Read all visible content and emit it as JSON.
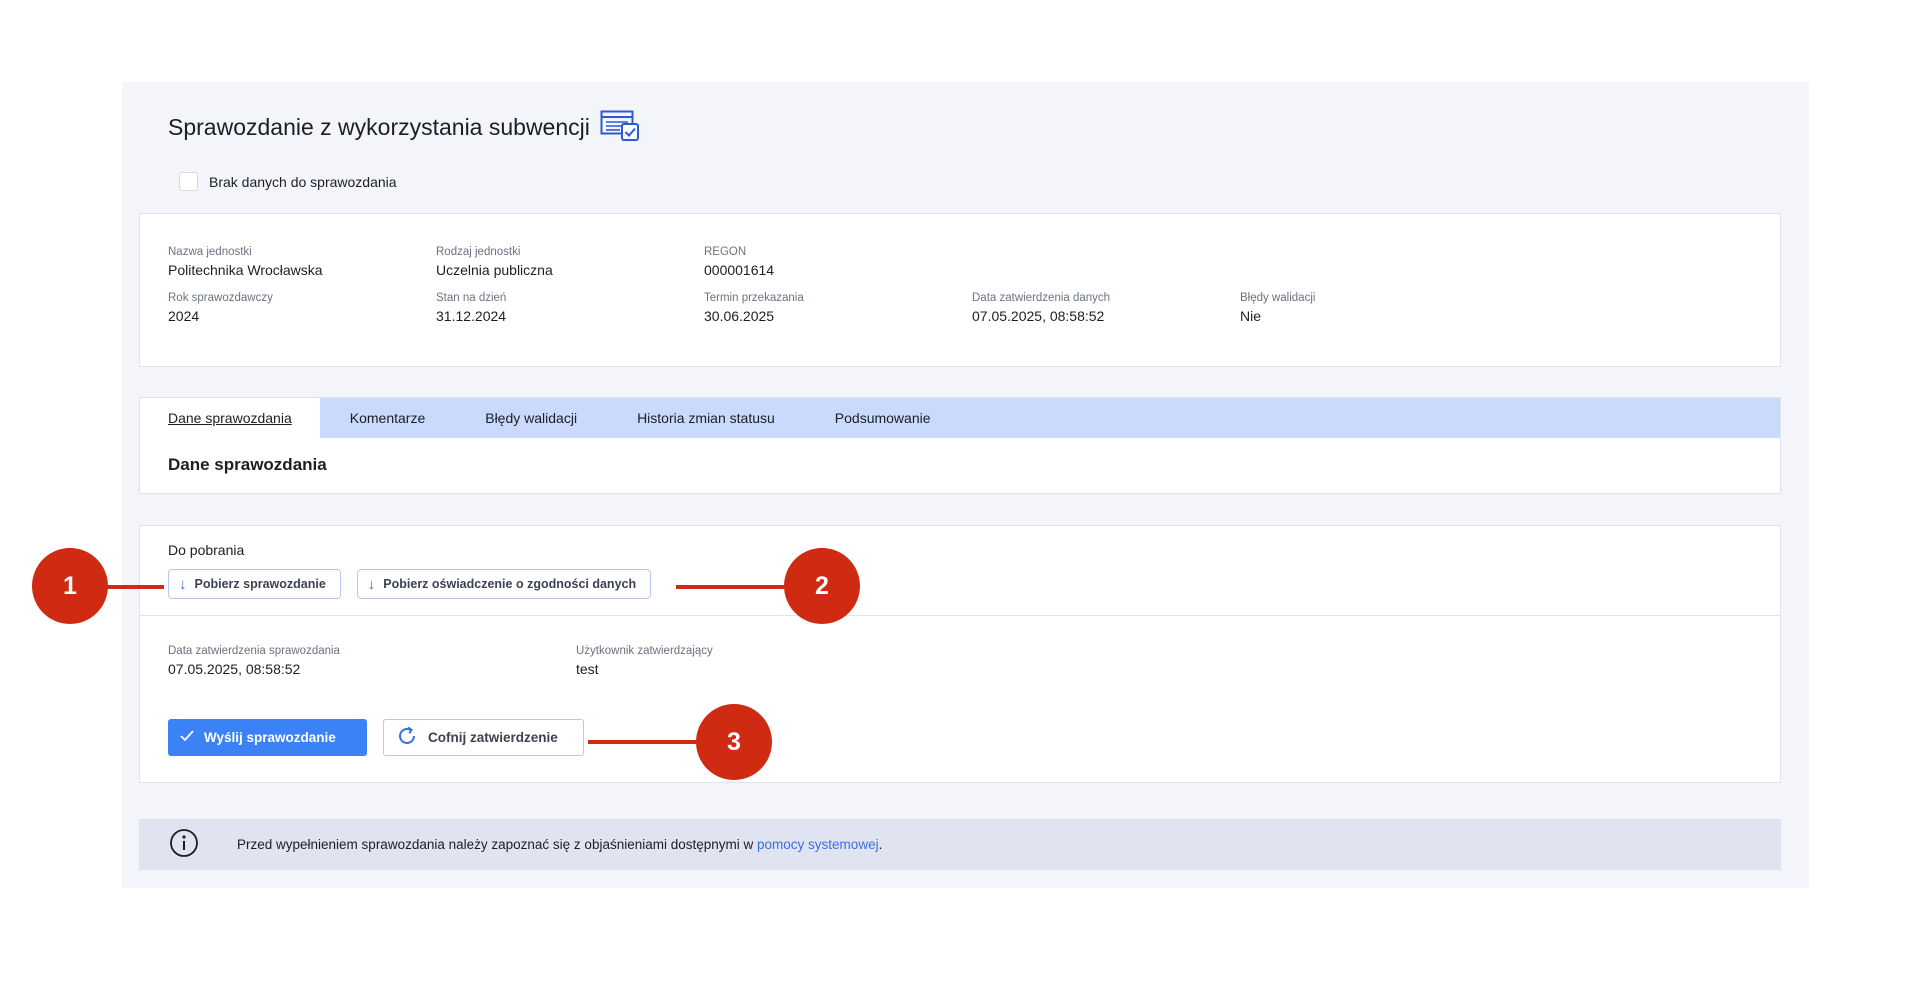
{
  "page": {
    "title": "Sprawozdanie z wykorzystania subwencji",
    "title_icon": "report-check-icon"
  },
  "no_data": {
    "label": "Brak danych do sprawozdania",
    "checked": false
  },
  "unit_info": [
    {
      "label": "Nazwa jednostki",
      "value": "Politechnika Wrocławska"
    },
    {
      "label": "Rodzaj jednostki",
      "value": "Uczelnia publiczna"
    },
    {
      "label": "REGON",
      "value": "000001614"
    },
    {
      "label": "",
      "value": ""
    },
    {
      "label": "",
      "value": ""
    },
    {
      "label": "Rok sprawozdawczy",
      "value": "2024"
    },
    {
      "label": "Stan na dzień",
      "value": "31.12.2024"
    },
    {
      "label": "Termin przekazania",
      "value": "30.06.2025"
    },
    {
      "label": "Data zatwierdzenia danych",
      "value": "07.05.2025, 08:58:52"
    },
    {
      "label": "Błędy walidacji",
      "value": "Nie"
    }
  ],
  "tabs": [
    {
      "label": "Dane sprawozdania",
      "active": true
    },
    {
      "label": "Komentarze",
      "active": false
    },
    {
      "label": "Błędy walidacji",
      "active": false
    },
    {
      "label": "Historia zmian statusu",
      "active": false
    },
    {
      "label": "Podsumowanie",
      "active": false
    }
  ],
  "section_title": "Dane sprawozdania",
  "downloads": {
    "label": "Do pobrania",
    "download_report": "Pobierz sprawozdanie",
    "download_statement": "Pobierz oświadczenie o zgodności danych",
    "icon": "arrow-down-icon"
  },
  "approval": {
    "date_label": "Data zatwierdzenia sprawozdania",
    "date_value": "07.05.2025, 08:58:52",
    "user_label": "Użytkownik zatwierdzający",
    "user_value": "test"
  },
  "actions": {
    "send_label": "Wyślij sprawozdanie",
    "undo_label": "Cofnij zatwierdzenie"
  },
  "notice": {
    "text": "Przed wypełnieniem sprawozdania należy zapoznać się z objaśnieniami dostępnymi w ",
    "link": "pomocy systemowej",
    "suffix": "."
  },
  "callouts": [
    "1",
    "2",
    "3"
  ],
  "colors": {
    "accent": "#3b82f6",
    "tabbar": "#c9dafc",
    "callout": "#cf2a12",
    "panel_bg": "#f3f5fa"
  }
}
